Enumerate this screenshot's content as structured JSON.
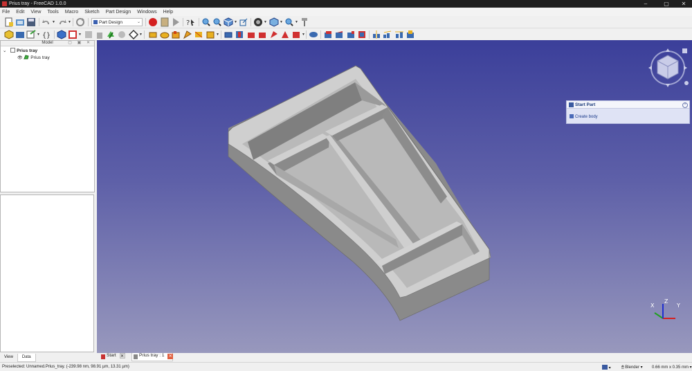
{
  "window": {
    "title": "Prius tray - FreeCAD 1.0.0",
    "minimize": "–",
    "maximize": "▢",
    "close": "✕"
  },
  "menu": [
    "File",
    "Edit",
    "View",
    "Tools",
    "Macro",
    "Sketch",
    "Part Design",
    "Windows",
    "Help"
  ],
  "workbench": {
    "selected": "Part Design"
  },
  "model_panel": {
    "title": "Model",
    "tree": [
      {
        "label": "Prius tray",
        "expanded": true
      },
      {
        "label": "Prius tray"
      }
    ]
  },
  "panel_tabs": [
    "View",
    "Data"
  ],
  "task_panel": {
    "title": "Start Part",
    "action": "Create body"
  },
  "doc_tabs": [
    {
      "label": "Start",
      "active": false
    },
    {
      "label": "Prius tray : 1",
      "active": true
    }
  ],
  "status": {
    "preselected": "Preselected: Unnamed.Prius_tray. (-239.98 nm, 98.91 µm, 13.31 µm)",
    "nav_style": "Blender",
    "dimensions": "0.66 mm x 0.35 mm"
  },
  "axis": {
    "x": "X",
    "y": "Y",
    "z": "Z"
  },
  "colors": {
    "bg_top": "#3b3f9a",
    "bg_bottom": "#9898bd",
    "part_fill": "#bdbdbd",
    "part_side": "#8e8e8e",
    "part_inner": "#7d7d7d",
    "axis_x": "#d42020",
    "axis_y": "#20a020",
    "axis_z": "#2030d0"
  }
}
